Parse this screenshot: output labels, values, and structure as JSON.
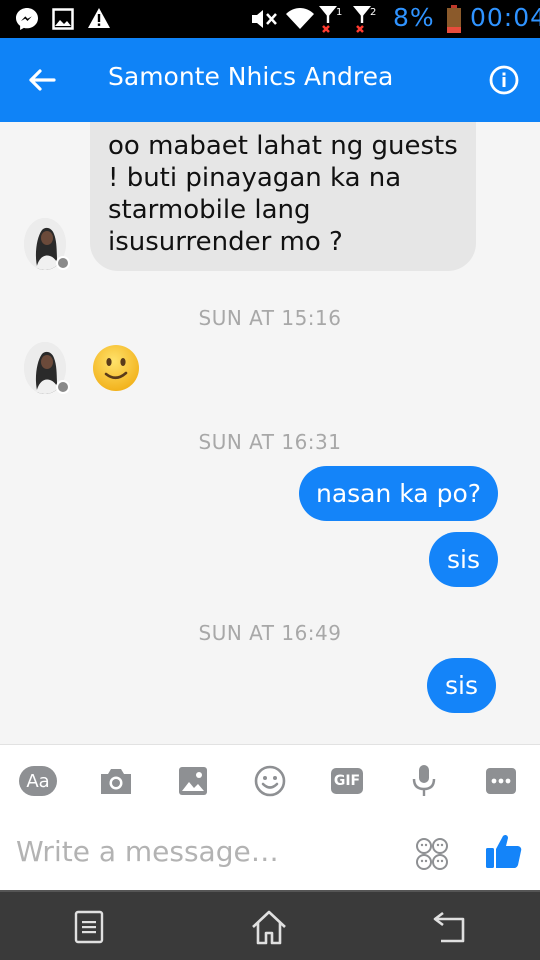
{
  "status_bar": {
    "battery_percent": "8%",
    "time": "00:04",
    "icons": [
      "messenger-icon",
      "gallery-icon",
      "warning-icon",
      "mute-icon",
      "wifi-icon",
      "signal-1-icon",
      "signal-2-icon",
      "battery-icon"
    ]
  },
  "header": {
    "title": "Samonte Nhics Andrea",
    "back_icon": "back-arrow-icon",
    "info_icon": "info-icon",
    "color": "#0f83f7"
  },
  "messages": [
    {
      "direction": "incoming",
      "lines": [
        "oo mabaet lahat ng guests",
        "! buti pinayagan ka na",
        "starmobile lang",
        "isusurrender mo ?"
      ]
    },
    {
      "type": "timestamp",
      "text": "SUN AT 15:16"
    },
    {
      "direction": "incoming",
      "emoji": "slightly-smiling-face"
    },
    {
      "type": "timestamp",
      "text": "SUN AT 16:31"
    },
    {
      "direction": "outgoing",
      "text": "nasan ka po?"
    },
    {
      "direction": "outgoing",
      "text": "sis"
    },
    {
      "type": "timestamp",
      "text": "SUN AT 16:49"
    },
    {
      "direction": "outgoing",
      "text": "sis"
    }
  ],
  "composer": {
    "placeholder": "Write a message…",
    "tools": [
      "text-format-icon",
      "camera-icon",
      "image-icon",
      "emoji-icon",
      "gif-icon",
      "microphone-icon",
      "more-icon"
    ],
    "format_label": "Aa",
    "gif_label": "GIF"
  },
  "colors": {
    "accent": "#0f83f7",
    "outgoing_bubble": "#1484f9",
    "incoming_bubble": "#e6e6e6",
    "timestamp": "#a8a8a8"
  },
  "navbar": {
    "buttons": [
      "recent-apps-icon",
      "home-icon",
      "back-icon"
    ]
  }
}
